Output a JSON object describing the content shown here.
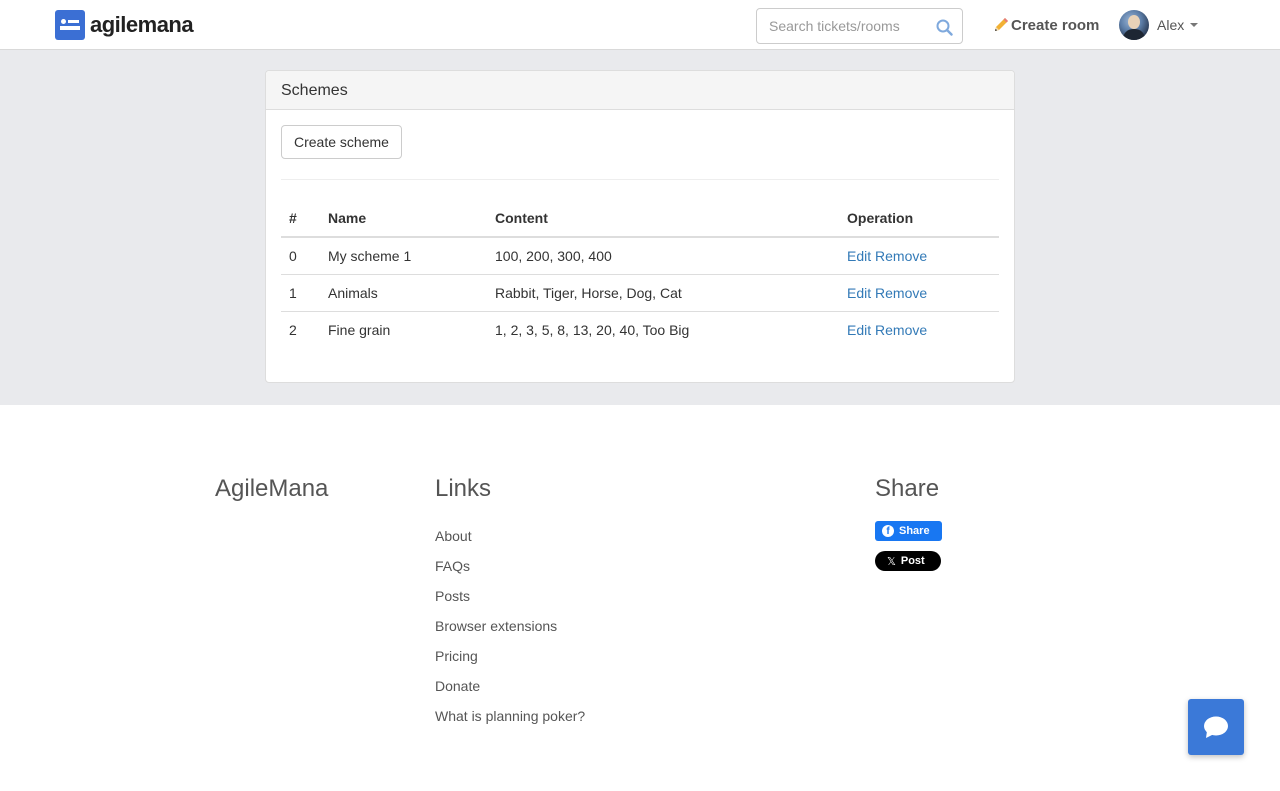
{
  "navbar": {
    "brand": "agilemana",
    "search_placeholder": "Search tickets/rooms",
    "create_room": "Create room",
    "user_name": "Alex"
  },
  "panel": {
    "title": "Schemes",
    "create_button": "Create scheme",
    "columns": [
      "#",
      "Name",
      "Content",
      "Operation"
    ],
    "rows": [
      {
        "index": "0",
        "name": "My scheme 1",
        "content": "100, 200, 300, 400",
        "edit": "Edit",
        "remove": "Remove"
      },
      {
        "index": "1",
        "name": "Animals",
        "content": "Rabbit, Tiger, Horse, Dog, Cat",
        "edit": "Edit",
        "remove": "Remove"
      },
      {
        "index": "2",
        "name": "Fine grain",
        "content": "1, 2, 3, 5, 8, 13, 20, 40, Too Big",
        "edit": "Edit",
        "remove": "Remove"
      }
    ]
  },
  "footer": {
    "brand": "AgileMana",
    "links_title": "Links",
    "links": [
      "About",
      "FAQs",
      "Posts",
      "Browser extensions",
      "Pricing",
      "Donate",
      "What is planning poker?"
    ],
    "share_title": "Share",
    "fb_share": "Share",
    "x_post": "Post"
  },
  "colors": {
    "brand_blue": "#3b6fd4",
    "link_blue": "#337ab7",
    "page_grey": "#e9eaed",
    "chat_blue": "#3b79d8"
  },
  "icons": [
    "search-icon",
    "pencil-icon",
    "avatar",
    "caret-down-icon",
    "facebook-icon",
    "x-icon",
    "chat-icon"
  ]
}
